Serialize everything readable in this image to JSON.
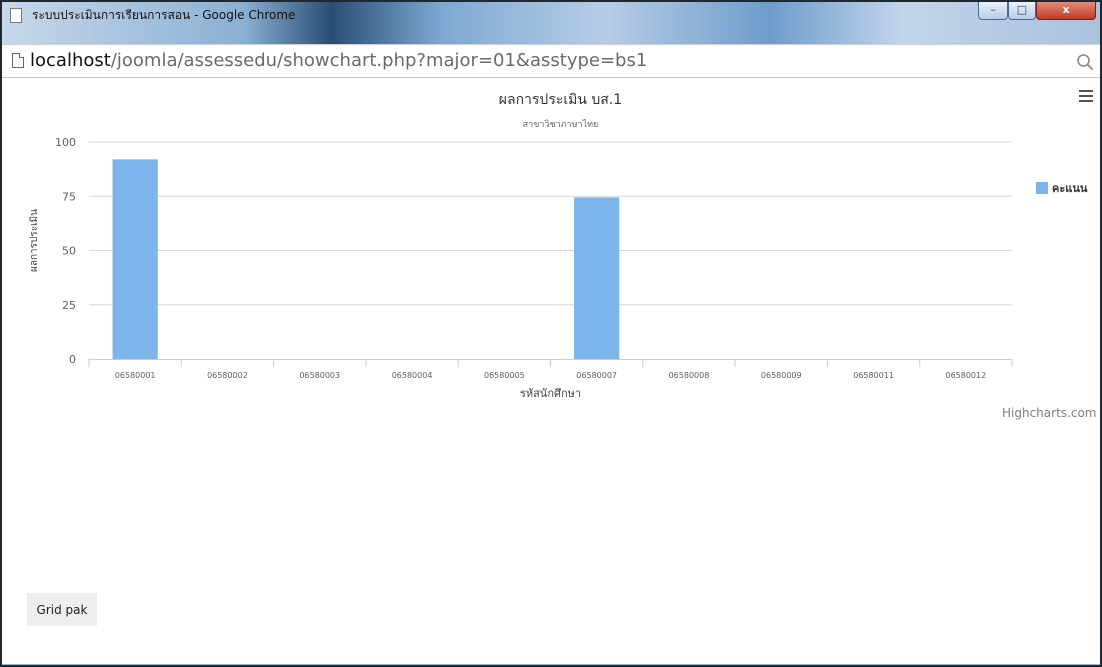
{
  "window": {
    "title": "ระบบประเมินการเรียนการสอน - Google Chrome",
    "minimize_label": "–",
    "maximize_label": "□",
    "close_label": "x"
  },
  "address_bar": {
    "url_host": "localhost",
    "url_path": "/joomla/assessedu/showchart.php?major=01&asstype=bs1"
  },
  "page": {
    "grid_button_label": "Grid pak",
    "credit": "Highcharts.com"
  },
  "chart_data": {
    "type": "bar",
    "title": "ผลการประเมิน บส.1",
    "subtitle": "สาขาวิชาภาษาไทย",
    "xlabel": "รหัสนักศึกษา",
    "ylabel": "ผลการประเมิน",
    "categories": [
      "06580001",
      "06580002",
      "06580003",
      "06580004",
      "06580005",
      "06580007",
      "06580008",
      "06580009",
      "06580011",
      "06580012"
    ],
    "series": [
      {
        "name": "คะแนน",
        "values": [
          92,
          0,
          0,
          0,
          0,
          74.5,
          0,
          0,
          0,
          0
        ],
        "color": "#7cb5ec"
      }
    ],
    "ylim": [
      0,
      100
    ],
    "yticks": [
      0,
      25,
      50,
      75,
      100
    ],
    "grid": true,
    "legend_position": "right"
  }
}
